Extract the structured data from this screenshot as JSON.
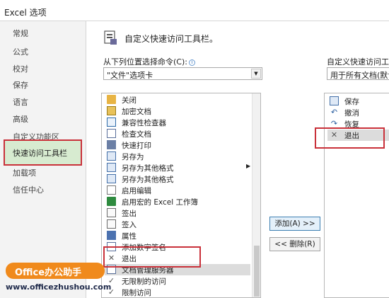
{
  "window": {
    "title": "Excel 选项"
  },
  "sidebar": {
    "items": [
      {
        "label": "常规"
      },
      {
        "label": "公式"
      },
      {
        "label": "校对"
      },
      {
        "label": "保存"
      },
      {
        "label": "语言"
      },
      {
        "label": "高级"
      },
      {
        "label": "自定义功能区"
      },
      {
        "label": "快速访问工具栏",
        "selected": true
      },
      {
        "label": "加载项"
      },
      {
        "label": "信任中心"
      }
    ]
  },
  "main": {
    "header": {
      "title": "自定义快速访问工具栏。",
      "icon": "toolbar-icon"
    },
    "left": {
      "label": "从下列位置选择命令(C):",
      "combo_value": "\"文件\"选项卡",
      "commands": [
        {
          "icon": "folder-icon",
          "label": "关闭"
        },
        {
          "icon": "lock-icon",
          "label": "加密文档"
        },
        {
          "icon": "check-icon",
          "label": "兼容性检查器"
        },
        {
          "icon": "inspect-icon",
          "label": "检查文档"
        },
        {
          "icon": "print-icon",
          "label": "快速打印"
        },
        {
          "icon": "save-as-icon",
          "label": "另存为"
        },
        {
          "icon": "save-as-icon",
          "label": "另存为其他格式",
          "has_submenu": true
        },
        {
          "icon": "save-as-icon",
          "label": "另存为其他格式"
        },
        {
          "icon": "edit-icon",
          "label": "启用编辑"
        },
        {
          "icon": "excel-icon",
          "label": "启用宏的 Excel 工作簿"
        },
        {
          "icon": "sign-icon",
          "label": "签出"
        },
        {
          "icon": "sign-icon",
          "label": "签入"
        },
        {
          "icon": "properties-icon",
          "label": "属性"
        },
        {
          "icon": "signature-icon",
          "label": "添加数字签名"
        },
        {
          "icon": "close-x-icon",
          "label": "退出"
        },
        {
          "icon": "doc-server-icon",
          "label": "文档管理服务器"
        },
        {
          "icon": "checkmark-icon",
          "label": "无限制的访问"
        },
        {
          "icon": "checkmark-icon",
          "label": "限制访问"
        }
      ]
    },
    "buttons": {
      "add": "添加(A) >>",
      "remove": "<< 删除(R)"
    },
    "right": {
      "label": "自定义快速访问工具栏",
      "combo_value": "用于所有文档(默认",
      "commands": [
        {
          "icon": "save-icon",
          "label": "保存"
        },
        {
          "icon": "undo-icon",
          "label": "撤消"
        },
        {
          "icon": "redo-icon",
          "label": "恢复"
        },
        {
          "icon": "close-x-icon",
          "label": "退出"
        }
      ]
    }
  },
  "watermark": {
    "brand": "Office办公助手",
    "url": "www.officezhushou.com"
  },
  "colors": {
    "selected_bg": "#d7ebd0",
    "highlight_box": "#c9313a",
    "watermark_bg": "#f08a1c"
  }
}
